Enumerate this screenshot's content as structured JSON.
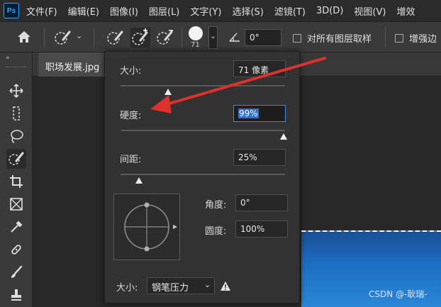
{
  "app": {
    "logo_text": "Ps"
  },
  "menu": {
    "items": [
      "文件(F)",
      "编辑(E)",
      "图像(I)",
      "图层(L)",
      "文字(Y)",
      "选择(S)",
      "滤镜(T)",
      "3D(D)",
      "视图(V)",
      "增效"
    ]
  },
  "options": {
    "brush_size_value": "71",
    "angle_value": "0°",
    "sample_all_layers_label": "对所有图层取样",
    "enhance_edge_label": "增强边"
  },
  "toolbar": {
    "tools": [
      "move-tool",
      "marquee-tool",
      "lasso-tool",
      "quick-selection-tool",
      "crop-tool",
      "frame-tool",
      "eyedropper-tool",
      "healing-brush-tool",
      "brush-tool",
      "stamp-tool"
    ]
  },
  "document": {
    "tab_label": "职场发展.jpg",
    "watermark": "CSDN @-耿瑞-"
  },
  "brush_panel": {
    "size_label": "大小:",
    "size_value": "71 像素",
    "size_pct": 0.29,
    "hardness_label": "硬度:",
    "hardness_value": "99%",
    "hardness_pct": 0.99,
    "spacing_label": "间距:",
    "spacing_value": "25%",
    "spacing_pct": 0.11,
    "angle_label": "角度:",
    "angle_value": "0°",
    "roundness_label": "圆度:",
    "roundness_value": "100%",
    "pressure_size_label": "大小:",
    "pressure_option": "钢笔压力"
  },
  "colors": {
    "annotation_arrow": "#e0302b",
    "selection_highlight": "#2f6fd0"
  }
}
